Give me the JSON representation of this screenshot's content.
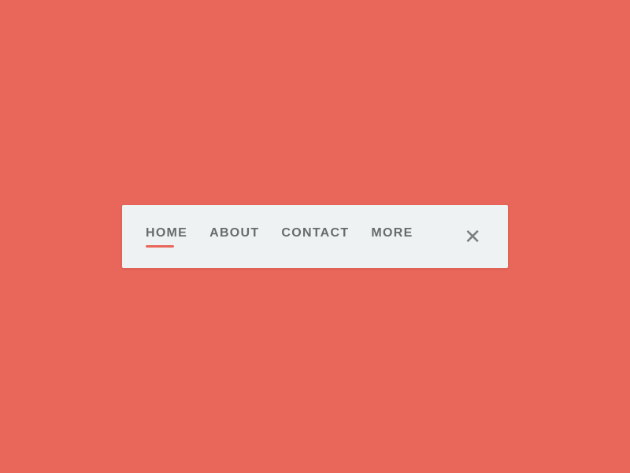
{
  "background_color": "#E8665A",
  "nav": {
    "items": [
      {
        "label": "HOME",
        "active": true
      },
      {
        "label": "ABOUT",
        "active": false
      },
      {
        "label": "CONTACT",
        "active": false
      },
      {
        "label": "MORE",
        "active": false
      }
    ],
    "close_label": "✕",
    "accent_color": "#E8665A"
  }
}
